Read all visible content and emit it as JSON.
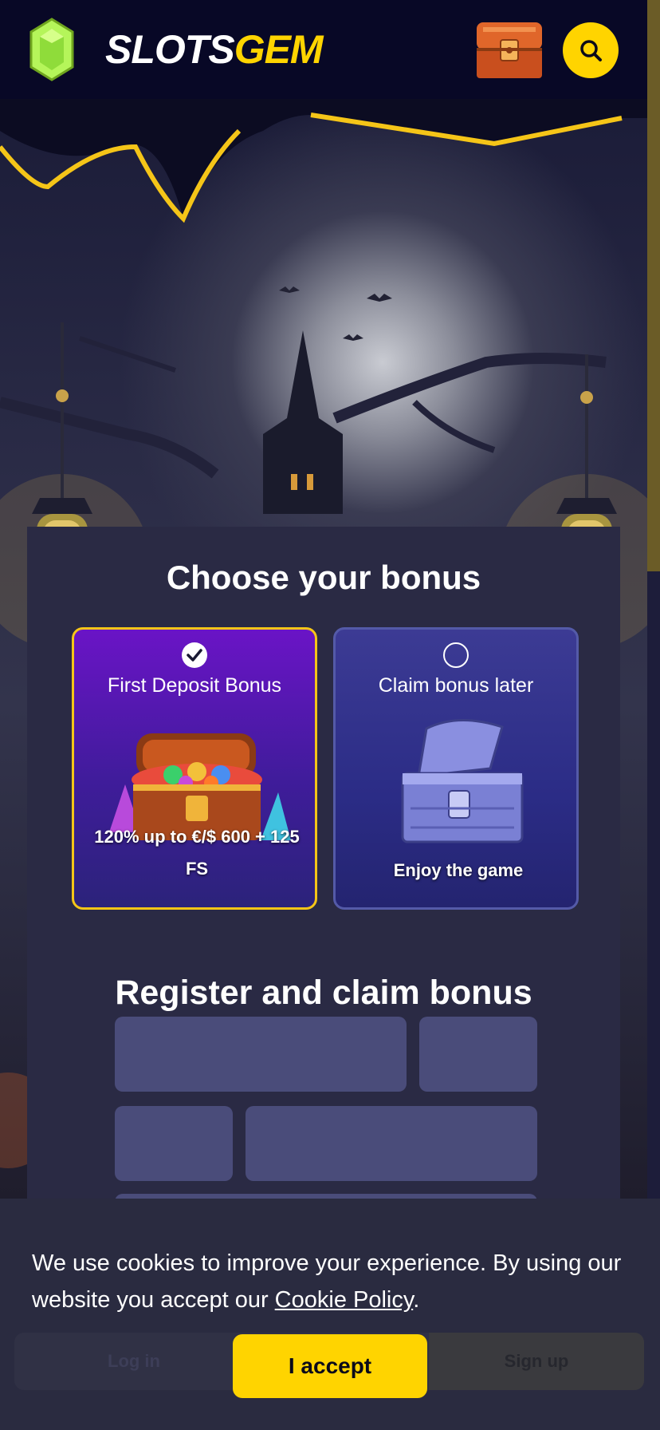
{
  "header": {
    "logo_slots": "SLOTS",
    "logo_gem": "GEM",
    "icons": [
      "gem-logo-icon",
      "treasure-chest-icon",
      "search-icon"
    ]
  },
  "bonus": {
    "title": "Choose your bonus",
    "cards": [
      {
        "title": "First Deposit Bonus",
        "description": "120% up to €/$ 600 + 125 FS",
        "selected": true
      },
      {
        "title": "Claim bonus later",
        "description": "Enjoy the game",
        "selected": false
      }
    ]
  },
  "register": {
    "title": "Register and claim bonus"
  },
  "cookie": {
    "text": "We use cookies to improve your experience. By using our website you accept our ",
    "link": "Cookie Policy",
    "text_end": ".",
    "accept_label": "I accept"
  },
  "bottom_nav": {
    "login_label": "Log in",
    "signup_label": "Sign up"
  },
  "colors": {
    "accent": "#ffd400",
    "header_bg": "#080826",
    "panel_bg": "#2a2a44",
    "selected_card_border": "#f5c518"
  }
}
